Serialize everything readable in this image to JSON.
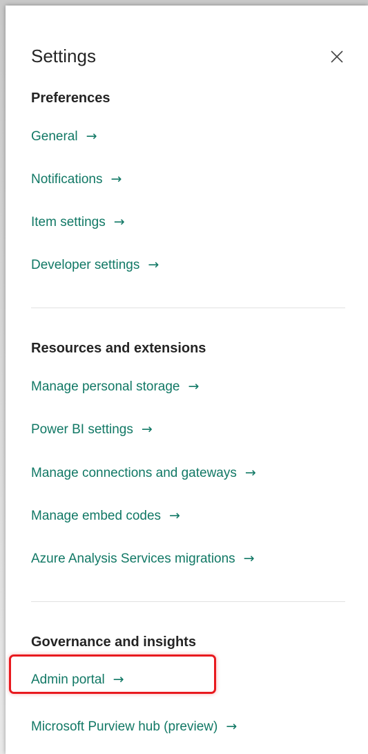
{
  "panel": {
    "title": "Settings"
  },
  "sections": {
    "preferences": {
      "heading": "Preferences",
      "items": [
        "General",
        "Notifications",
        "Item settings",
        "Developer settings"
      ]
    },
    "resources": {
      "heading": "Resources and extensions",
      "items": [
        "Manage personal storage",
        "Power BI settings",
        "Manage connections and gateways",
        "Manage embed codes",
        "Azure Analysis Services migrations"
      ]
    },
    "governance": {
      "heading": "Governance and insights",
      "items": [
        "Admin portal",
        "Microsoft Purview hub (preview)"
      ]
    }
  },
  "icons": {
    "close": "close-icon",
    "arrow": "arrow-right-icon"
  },
  "colors": {
    "link": "#117865",
    "heading": "#242424",
    "highlight": "#e8191e"
  }
}
